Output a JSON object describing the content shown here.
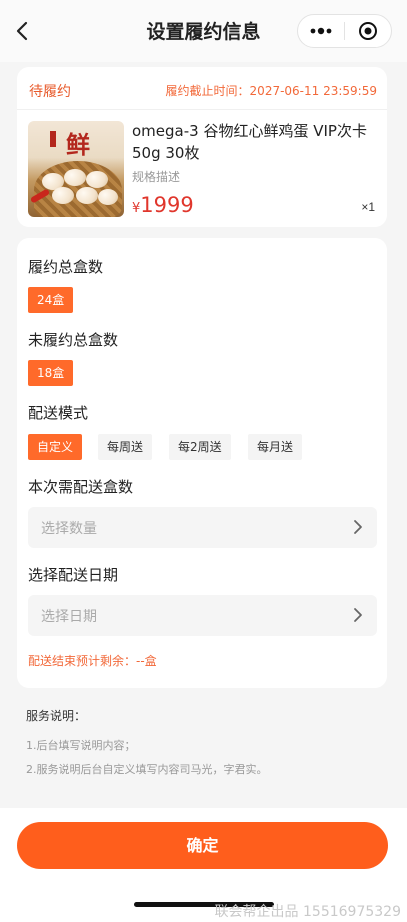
{
  "navbar": {
    "title": "设置履约信息",
    "back_icon": "chevron-left-icon",
    "more_icon": "more-dots-icon",
    "target_icon": "target-icon"
  },
  "order": {
    "status": "待履约",
    "deadline": "履约截止时间：2027-06-11 23:59:59",
    "product": {
      "image_text": "鲜",
      "name": "omega-3 谷物红心鲜鸡蛋 VIP次卡 50g 30枚",
      "spec": "规格描述",
      "currency": "¥",
      "price": "1999",
      "quantity": "×1"
    }
  },
  "form": {
    "total_boxes_label": "履约总盒数",
    "total_boxes_value": "24盒",
    "unfulfilled_label": "未履约总盒数",
    "unfulfilled_value": "18盒",
    "delivery_mode_label": "配送模式",
    "delivery_modes": [
      {
        "label": "自定义",
        "selected": true
      },
      {
        "label": "每周送",
        "selected": false
      },
      {
        "label": "每2周送",
        "selected": false
      },
      {
        "label": "每月送",
        "selected": false
      }
    ],
    "quantity_label": "本次需配送盒数",
    "quantity_placeholder": "选择数量",
    "date_label": "选择配送日期",
    "date_placeholder": "选择日期",
    "remaining_note": "配送结束预计剩余：--盒"
  },
  "service": {
    "title": "服务说明：",
    "lines": [
      "1.后台填写说明内容；",
      "2.服务说明后台自定义填写内容司马光，字君实。"
    ]
  },
  "footer": {
    "confirm_label": "确定",
    "watermark": "联会帮企出品 15516975329"
  },
  "colors": {
    "accent": "#ff6a2a",
    "button": "#ff5e1c",
    "price": "#e0362c",
    "warning_text": "#f2693a"
  }
}
